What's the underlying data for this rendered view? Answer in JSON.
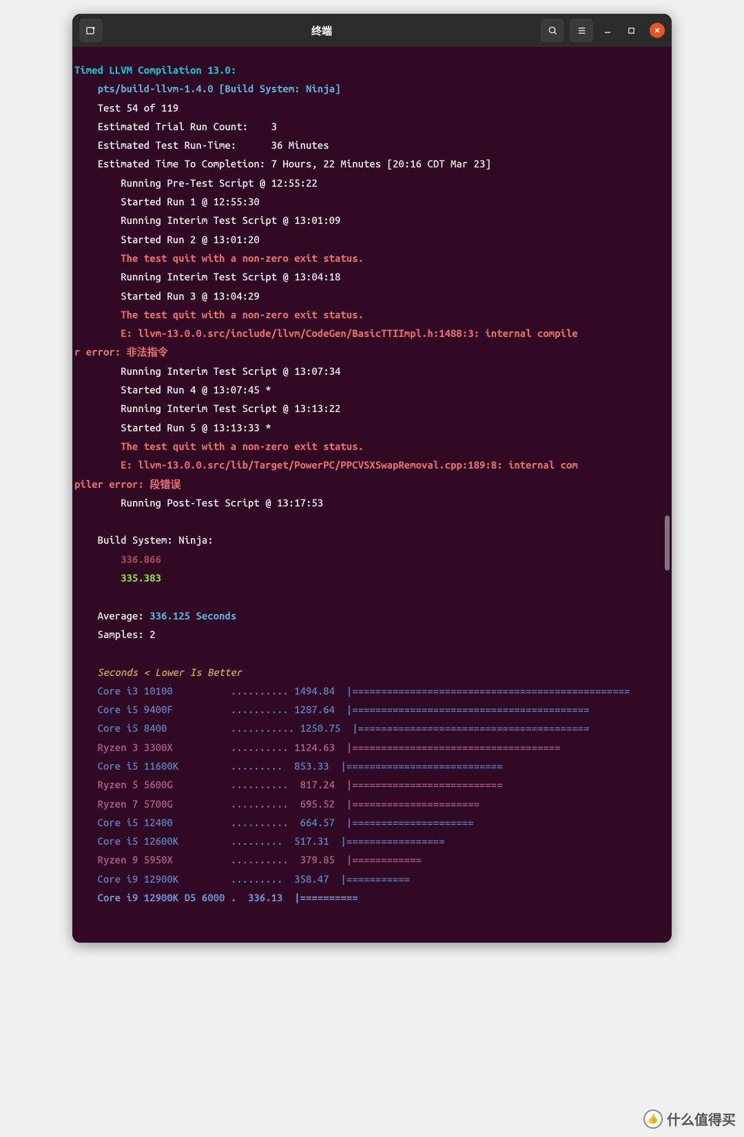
{
  "window": {
    "title": "终端"
  },
  "header": {
    "title_line": "Timed LLVM Compilation 13.0:",
    "subtitle": "pts/build-llvm-1.4.0 [Build System: Ninja]",
    "test_of": "Test 54 of 119",
    "trial_count_label": "Estimated Trial Run Count:    3",
    "runtime_label": "Estimated Test Run-Time:      36 Minutes",
    "eta_label": "Estimated Time To Completion: 7 Hours, 22 Minutes [20:16 CDT Mar 23]"
  },
  "log": {
    "l1": "Running Pre-Test Script @ 12:55:22",
    "l2": "Started Run 1 @ 12:55:30",
    "l3": "Running Interim Test Script @ 13:01:09",
    "l4": "Started Run 2 @ 13:01:20",
    "e1": "The test quit with a non-zero exit status.",
    "l5": "Running Interim Test Script @ 13:04:18",
    "l6": "Started Run 3 @ 13:04:29",
    "e2": "The test quit with a non-zero exit status.",
    "e3a": "E: llvm-13.0.0.src/include/llvm/CodeGen/BasicTTIImpl.h:1488:3: internal compile",
    "e3b": "r error: 非法指令",
    "l7": "Running Interim Test Script @ 13:07:34",
    "l8": "Started Run 4 @ 13:07:45 *",
    "l9": "Running Interim Test Script @ 13:13:22",
    "l10": "Started Run 5 @ 13:13:33 *",
    "e4": "The test quit with a non-zero exit status.",
    "e5a": "E: llvm-13.0.0.src/lib/Target/PowerPC/PPCVSXSwapRemoval.cpp:189:8: internal com",
    "e5b": "piler error: 段错误",
    "l11": "Running Post-Test Script @ 13:17:53"
  },
  "results": {
    "build_label": "Build System: Ninja:",
    "r1": "336.866",
    "r2": "335.383",
    "avg_label": "Average: ",
    "avg_value": "336.125 Seconds",
    "samples": "Samples: 2",
    "note": "Seconds < Lower Is Better"
  },
  "chart_data": {
    "type": "bar",
    "title": "Seconds < Lower Is Better",
    "xlabel": "",
    "ylabel": "Seconds",
    "rows": [
      {
        "label": "Core i3 10100",
        "dots": "..........",
        "value": "1494.84",
        "bar": "================================================",
        "c": "blue"
      },
      {
        "label": "Core i5 9400F",
        "dots": "..........",
        "value": "1287.64",
        "bar": "=========================================",
        "c": "blue"
      },
      {
        "label": "Core i5 8400",
        "dots": "...........",
        "value": "1250.75",
        "bar": "========================================",
        "c": "blue"
      },
      {
        "label": "Ryzen 3 3300X",
        "dots": "..........",
        "value": "1124.63",
        "bar": "====================================",
        "c": "red"
      },
      {
        "label": "Core i5 11600K",
        "dots": ".........",
        "value": "853.33",
        "bar": "===========================",
        "c": "blue"
      },
      {
        "label": "Ryzen 5 5600G",
        "dots": "..........",
        "value": "817.24",
        "bar": "==========================",
        "c": "red"
      },
      {
        "label": "Ryzen 7 5700G",
        "dots": "..........",
        "value": "695.52",
        "bar": "======================",
        "c": "red"
      },
      {
        "label": "Core i5 12400",
        "dots": "..........",
        "value": "664.57",
        "bar": "=====================",
        "c": "blue"
      },
      {
        "label": "Core i5 12600K",
        "dots": ".........",
        "value": "517.31",
        "bar": "=================",
        "c": "blue"
      },
      {
        "label": "Ryzen 9 5950X",
        "dots": "..........",
        "value": "379.85",
        "bar": "============",
        "c": "red"
      },
      {
        "label": "Core i9 12900K",
        "dots": ".........",
        "value": "358.47",
        "bar": "===========",
        "c": "blue"
      },
      {
        "label": "Core i9 12900K D5 6000",
        "dots": ".",
        "value": "336.13",
        "bar": "==========",
        "c": "blue-bold"
      }
    ]
  },
  "watermark": "什么值得买"
}
